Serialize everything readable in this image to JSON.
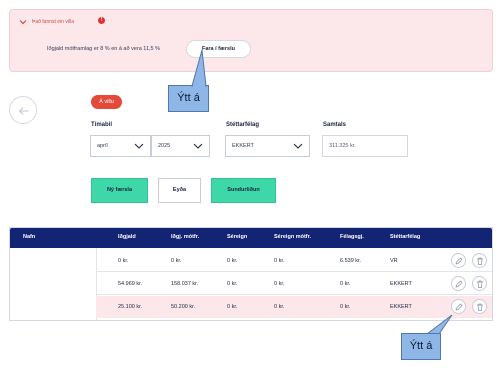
{
  "alert": {
    "title": "Það fannst ein villa",
    "message": "Iðgjald mótframlag er 8 % en á að vera 11,5 %",
    "goto_button": "Fara í færslu",
    "color": "#fce8ea"
  },
  "callouts": [
    "Ýtt á",
    "Ýtt á"
  ],
  "warning_badge": "Á villu",
  "form": {
    "period_label": "Tímabil",
    "month_value": "apríl",
    "year_value": "2025",
    "union_label": "Stéttarfélag",
    "union_value": "EKKERT",
    "total_label": "Samtals",
    "total_value": "311.325 kr."
  },
  "actions": {
    "new_entry": "Ný færsla",
    "delete": "Eyða",
    "split": "Sundurliðun"
  },
  "table": {
    "columns": [
      "Nafn",
      "Iðgjald",
      "Iðgj. mótfr.",
      "Séreign",
      "Séreign mótfr.",
      "Félagsgj.",
      "Stéttarfélag"
    ],
    "rows": [
      [
        "0 kr.",
        "0 kr.",
        "0 kr.",
        "0 kr.",
        "6.539 kr.",
        "VR"
      ],
      [
        "54.969 kr.",
        "158.037 kr.",
        "0 kr.",
        "0 kr.",
        "0 kr.",
        "EKKERT"
      ],
      [
        "25.100 kr.",
        "50.200 kr.",
        "0 kr.",
        "0 kr.",
        "0 kr.",
        "EKKERT"
      ]
    ],
    "header_color": "#142474",
    "error_row_color": "#fce8ea"
  },
  "icons": [
    "chevron-down-icon",
    "error-icon",
    "arrow-left-icon",
    "edit-icon",
    "trash-icon"
  ]
}
